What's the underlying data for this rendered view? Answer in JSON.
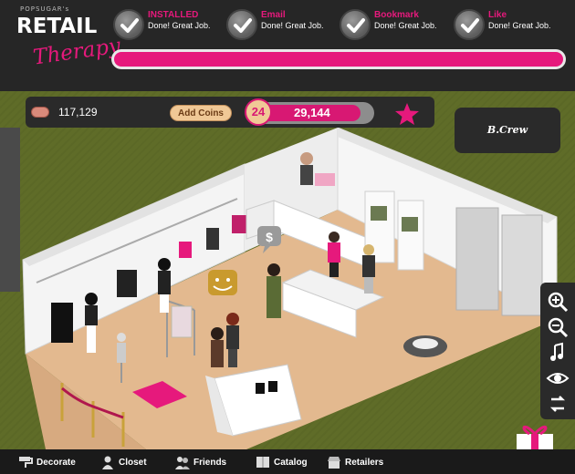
{
  "header": {
    "logo": {
      "brand_small": "POPSUGAR's",
      "brand_line1": "RETAIL",
      "brand_line2": "Therapy"
    },
    "achievements": [
      {
        "name": "INSTALLED",
        "status": "Done! Great Job."
      },
      {
        "name": "Email",
        "status": "Done! Great Job."
      },
      {
        "name": "Bookmark",
        "status": "Done! Great Job."
      },
      {
        "name": "Like",
        "status": "Done! Great Job."
      }
    ],
    "progress_fraction": 1.0
  },
  "hud": {
    "coins": "117,129",
    "add_coins_label": "Add Coins",
    "level": "24",
    "xp": "29,144",
    "xp_fraction": 0.88,
    "crew_label": "B.Crew"
  },
  "scene": {
    "speech_icon": "dollar-sign",
    "mood_icon": "smiley-face"
  },
  "tools": [
    {
      "icon": "zoom-in-icon"
    },
    {
      "icon": "zoom-out-icon"
    },
    {
      "icon": "music-note-icon"
    },
    {
      "icon": "eye-icon"
    },
    {
      "icon": "rotate-icon"
    }
  ],
  "nav": {
    "decorate": "Decorate",
    "closet": "Closet",
    "friends": "Friends",
    "catalog": "Catalog",
    "retailers": "Retailers"
  },
  "colors": {
    "brand_pink": "#e6197c",
    "floor": "#e3b98f",
    "grass": "#5f6c28",
    "wall": "#f4f4f4"
  }
}
